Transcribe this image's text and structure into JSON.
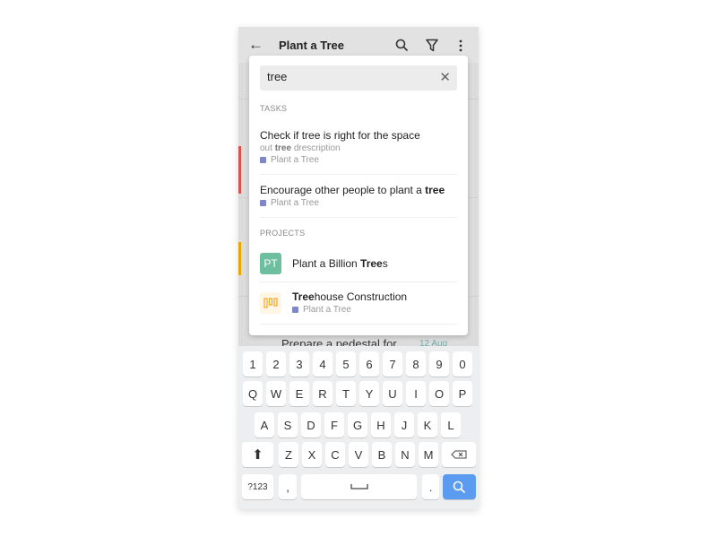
{
  "header": {
    "title": "Plant a Tree",
    "back_icon": "arrow-left-icon",
    "search_icon": "search-icon",
    "filter_icon": "filter-icon",
    "more_icon": "more-vertical-icon"
  },
  "background": {
    "partial_task": "Prepare a pedestal for",
    "partial_date": "12 Aug",
    "bar_colors": [
      "#d9534f",
      "#e6a700"
    ]
  },
  "search": {
    "value": "tree",
    "clear_icon": "close-icon"
  },
  "tasks_label": "TASKS",
  "tasks": [
    {
      "title_pre": "Check if ",
      "title_match": "tree",
      "title_post": " is right for the space",
      "desc_pre": "out ",
      "desc_match": "tree",
      "desc_post": " drescription",
      "project": "Plant a Tree"
    },
    {
      "title_pre": "Encourage other people to plant a ",
      "title_match": "tree",
      "title_post": "",
      "project": "Plant a Tree"
    }
  ],
  "projects_label": "PROJECTS",
  "projects": [
    {
      "avatar": "PT",
      "avatar_color": "#6dbf9f",
      "name_pre": "Plant a Billion ",
      "name_match": "Tree",
      "name_post": "s"
    },
    {
      "avatar_icon": "board-columns-icon",
      "avatar_color": "#f5a623",
      "name_pre": "",
      "name_match": "Tree",
      "name_post": "house Construction",
      "project": "Plant a Tree"
    }
  ],
  "keyboard": {
    "row1": [
      "1",
      "2",
      "3",
      "4",
      "5",
      "6",
      "7",
      "8",
      "9",
      "0"
    ],
    "row2": [
      "Q",
      "W",
      "E",
      "R",
      "T",
      "Y",
      "U",
      "I",
      "O",
      "P"
    ],
    "row3": [
      "A",
      "S",
      "D",
      "F",
      "G",
      "H",
      "J",
      "K",
      "L"
    ],
    "row4": [
      "Z",
      "X",
      "C",
      "V",
      "B",
      "N",
      "M"
    ],
    "symbols": "?123",
    "comma": ",",
    "period": ".",
    "search_color": "#5b9cf0"
  }
}
